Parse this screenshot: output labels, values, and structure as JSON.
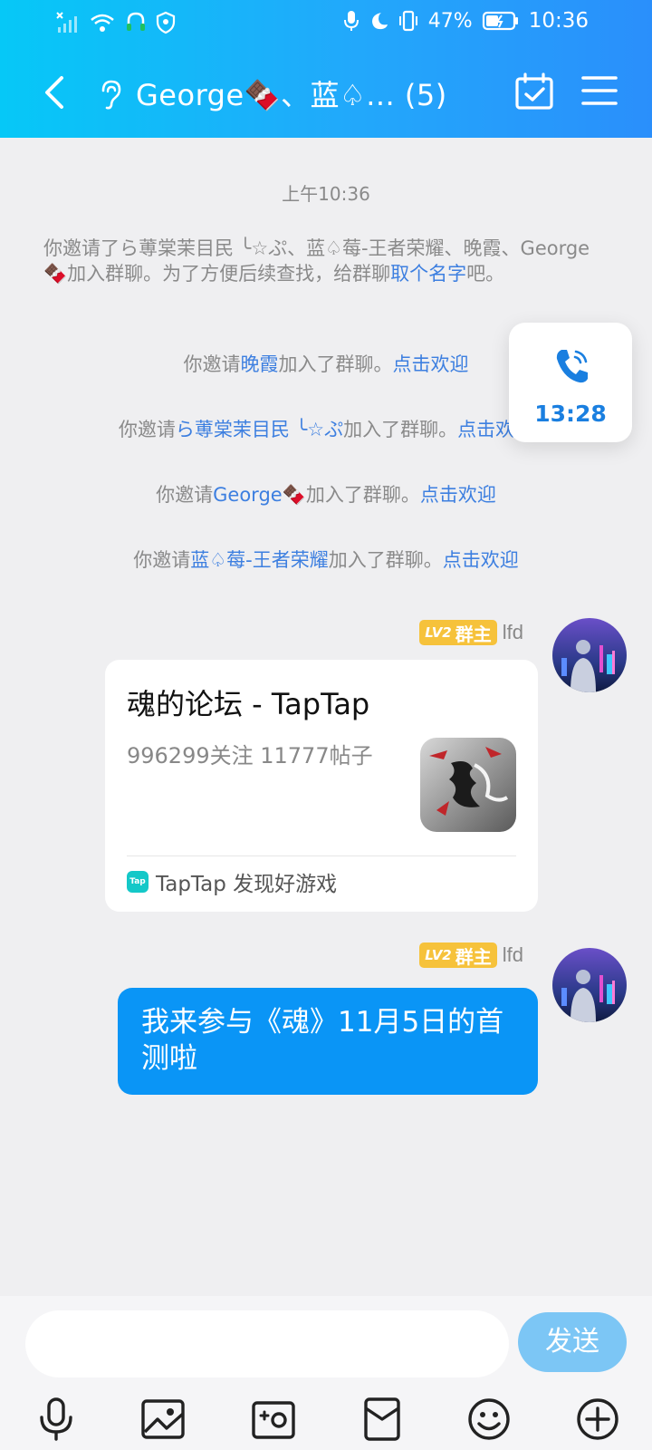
{
  "status_bar": {
    "battery": "47%",
    "time": "10:36"
  },
  "header": {
    "title": "George🍫、蓝♤... (5)"
  },
  "chat": {
    "timestamp": "上午10:36",
    "system_multi": {
      "part1": "你邀请了ら蒪棠茉目民 ╰☆ぷ、蓝♤莓-王者荣耀、晚霞、George🍫加入群聊。为了方便后续查找，给群聊",
      "link": "取个名字",
      "part2": "吧。"
    },
    "system_lines": [
      {
        "pre": "你邀请",
        "name": "晚霞",
        "mid": "加入了群聊。",
        "action": "点击欢迎"
      },
      {
        "pre": "你邀请",
        "name": "ら蒪棠茉目民 ╰☆ぷ",
        "mid": "加入了群聊。",
        "action": "点击欢迎"
      },
      {
        "pre": "你邀请",
        "name": "George🍫",
        "mid": "加入了群聊。",
        "action": "点击欢迎"
      },
      {
        "pre": "你邀请",
        "name": "蓝♤莓-王者荣耀",
        "mid": "加入了群聊。",
        "action": "点击欢迎"
      }
    ],
    "call": {
      "duration": "13:28"
    },
    "messages": [
      {
        "sender": {
          "level": "LV2",
          "role": "群主",
          "name": "lfd"
        },
        "card": {
          "title": "魂的论坛 - TapTap",
          "desc": "996299关注 11777帖子",
          "logo": "Tap",
          "source": "TapTap 发现好游戏"
        }
      },
      {
        "sender": {
          "level": "LV2",
          "role": "群主",
          "name": "lfd"
        },
        "text": "我来参与《魂》11月5日的首测啦"
      }
    ]
  },
  "input_bar": {
    "placeholder": "",
    "send_label": "发送"
  },
  "toolbar": {
    "items": [
      "mic-icon",
      "image-icon",
      "camera-icon",
      "red-packet-icon",
      "emoji-icon",
      "plus-icon"
    ]
  },
  "colors": {
    "header_start": "#06c8f7",
    "header_end": "#2a8ffb",
    "link": "#3d7fe0",
    "bubble": "#0a95f6",
    "badge": "#f6c23b"
  }
}
